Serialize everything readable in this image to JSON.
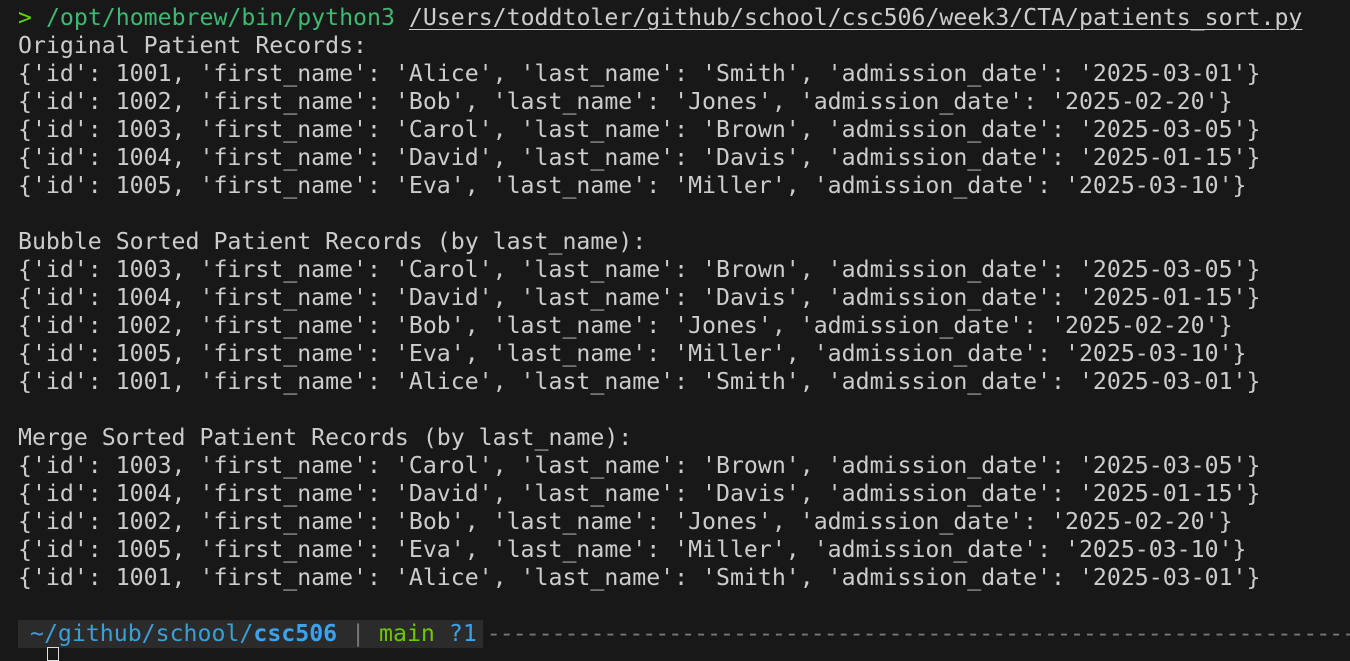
{
  "command": {
    "prompt": ">",
    "exe": "/opt/homebrew/bin/python3",
    "script": "/Users/toddtoler/github/school/csc506/week3/CTA/patients_sort.py"
  },
  "output_lines": [
    "Original Patient Records:",
    "{'id': 1001, 'first_name': 'Alice', 'last_name': 'Smith', 'admission_date': '2025-03-01'}",
    "{'id': 1002, 'first_name': 'Bob', 'last_name': 'Jones', 'admission_date': '2025-02-20'}",
    "{'id': 1003, 'first_name': 'Carol', 'last_name': 'Brown', 'admission_date': '2025-03-05'}",
    "{'id': 1004, 'first_name': 'David', 'last_name': 'Davis', 'admission_date': '2025-01-15'}",
    "{'id': 1005, 'first_name': 'Eva', 'last_name': 'Miller', 'admission_date': '2025-03-10'}",
    "",
    "Bubble Sorted Patient Records (by last_name):",
    "{'id': 1003, 'first_name': 'Carol', 'last_name': 'Brown', 'admission_date': '2025-03-05'}",
    "{'id': 1004, 'first_name': 'David', 'last_name': 'Davis', 'admission_date': '2025-01-15'}",
    "{'id': 1002, 'first_name': 'Bob', 'last_name': 'Jones', 'admission_date': '2025-02-20'}",
    "{'id': 1005, 'first_name': 'Eva', 'last_name': 'Miller', 'admission_date': '2025-03-10'}",
    "{'id': 1001, 'first_name': 'Alice', 'last_name': 'Smith', 'admission_date': '2025-03-01'}",
    "",
    "Merge Sorted Patient Records (by last_name):",
    "{'id': 1003, 'first_name': 'Carol', 'last_name': 'Brown', 'admission_date': '2025-03-05'}",
    "{'id': 1004, 'first_name': 'David', 'last_name': 'Davis', 'admission_date': '2025-01-15'}",
    "{'id': 1002, 'first_name': 'Bob', 'last_name': 'Jones', 'admission_date': '2025-02-20'}",
    "{'id': 1005, 'first_name': 'Eva', 'last_name': 'Miller', 'admission_date': '2025-03-10'}",
    "{'id': 1001, 'first_name': 'Alice', 'last_name': 'Smith', 'admission_date': '2025-03-01'}"
  ],
  "status": {
    "dir_prefix": "~/github/school/",
    "dir_current": "csc506",
    "separator": "|",
    "branch": "main",
    "git_status": "?1"
  }
}
